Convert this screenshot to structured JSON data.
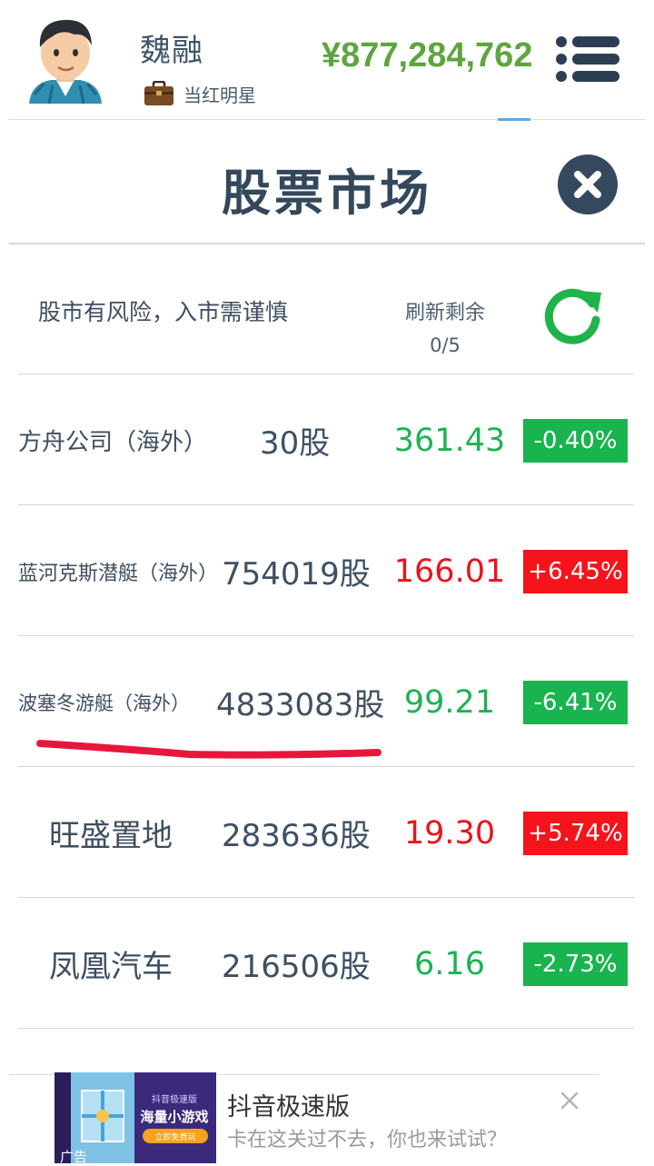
{
  "header": {
    "player_name": "魏融",
    "title": "当红明星",
    "money": "¥877,284,762"
  },
  "panel": {
    "title": "股票市场",
    "notice": "股市有风险，入市需谨慎",
    "refresh_label": "刷新剩余",
    "refresh_count": "0/5"
  },
  "stocks": [
    {
      "name": "方舟公司（海外）",
      "shares": "30股",
      "price": "361.43",
      "change": "-0.40%",
      "direction": "down"
    },
    {
      "name": "蓝河克斯潜艇（海外）",
      "shares": "754019股",
      "price": "166.01",
      "change": "+6.45%",
      "direction": "up"
    },
    {
      "name": "波塞冬游艇（海外）",
      "shares": "4833083股",
      "price": "99.21",
      "change": "-6.41%",
      "direction": "down"
    },
    {
      "name": "旺盛置地",
      "shares": "283636股",
      "price": "19.30",
      "change": "+5.74%",
      "direction": "up"
    },
    {
      "name": "凤凰汽车",
      "shares": "216506股",
      "price": "6.16",
      "change": "-2.73%",
      "direction": "down"
    }
  ],
  "ad": {
    "app_name": "抖音极速版",
    "subtitle": "卡在这关过不去，你也来试试？",
    "image_line1": "抖音极速版",
    "image_line2": "海量小游戏",
    "image_button": "立即免费玩",
    "tag": "广告"
  },
  "colors": {
    "up": "#e8141b",
    "down": "#1db255",
    "money": "#5ea53f",
    "badge_down": "#19b44f",
    "badge_up": "#f5141b",
    "text": "#3e4e60"
  },
  "icons": {
    "menu": "hamburger-menu-icon",
    "close": "close-circle-icon",
    "refresh": "refresh-icon",
    "briefcase": "briefcase-icon"
  }
}
